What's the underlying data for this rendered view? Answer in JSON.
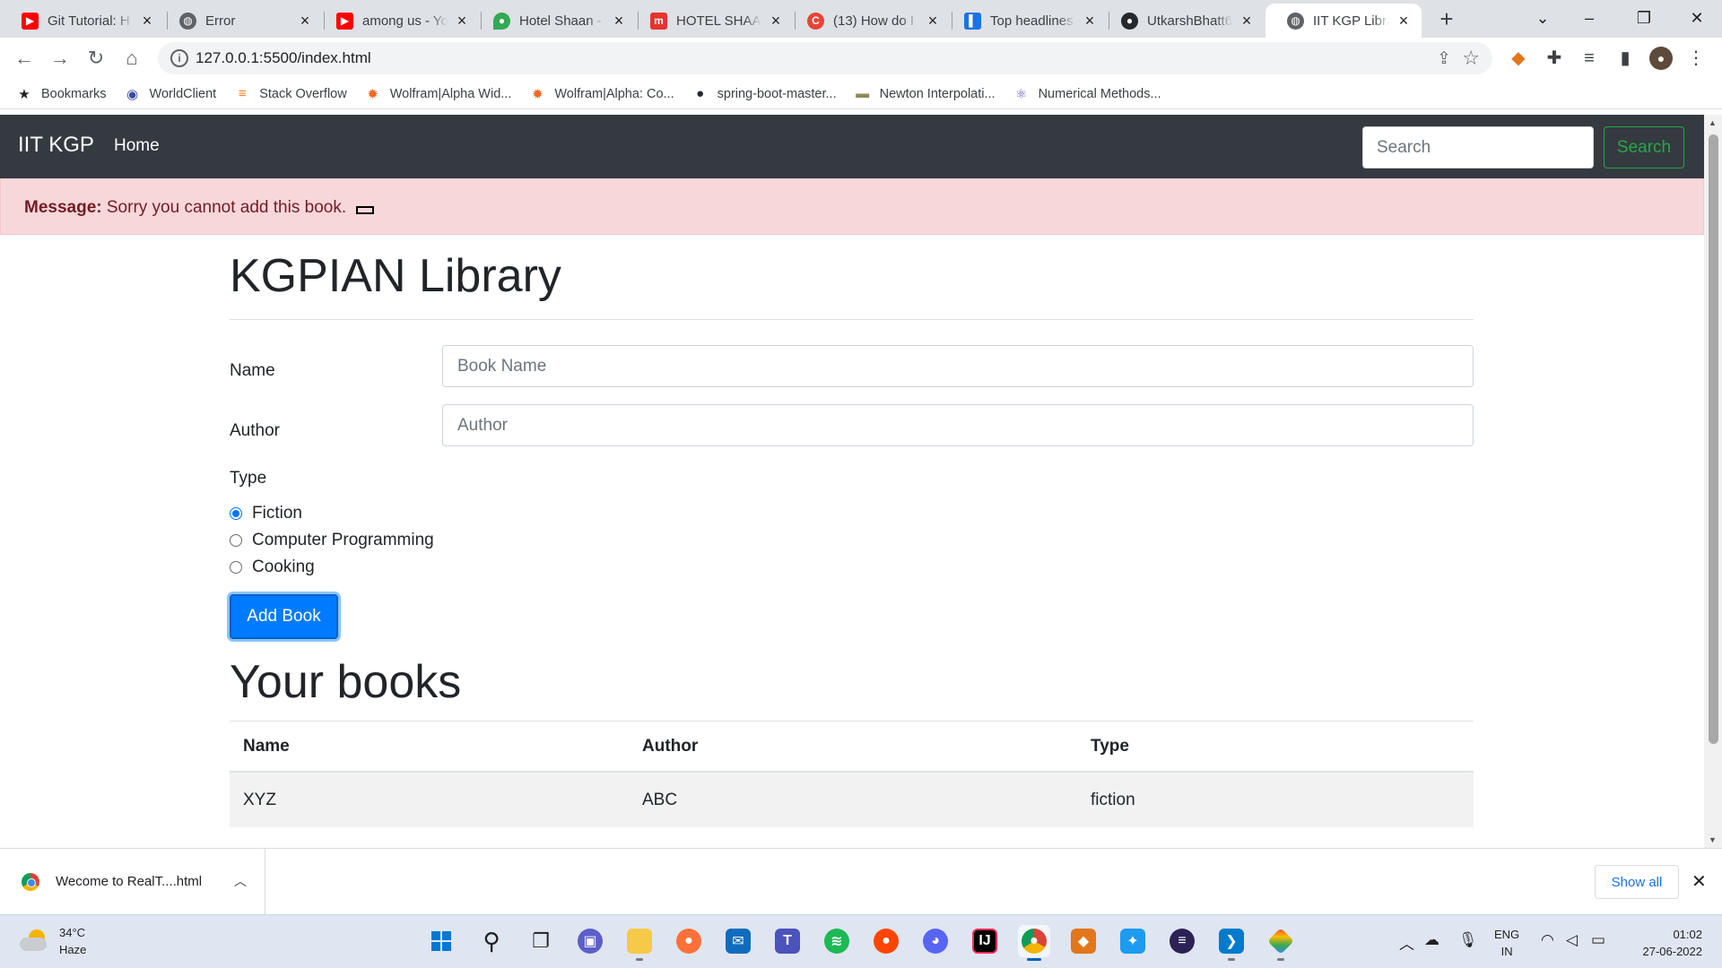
{
  "browser": {
    "tabs": [
      {
        "title": "Git Tutorial: H",
        "icon": "youtube-icon",
        "color": "#ff0000",
        "glyph": "▶"
      },
      {
        "title": "Error",
        "icon": "globe-icon",
        "color": "#5f6368",
        "glyph": "◍"
      },
      {
        "title": "among us - Yo",
        "icon": "youtube-icon",
        "color": "#ff0000",
        "glyph": "▶"
      },
      {
        "title": "Hotel Shaan -",
        "icon": "maps-pin-icon",
        "color": "#34a853",
        "glyph": "●"
      },
      {
        "title": "HOTEL SHAAN",
        "icon": "makemytrip-icon",
        "color": "#e7322d",
        "glyph": "m"
      },
      {
        "title": "(13) How do I",
        "icon": "quora-icon",
        "color": "#ea4335",
        "glyph": "C"
      },
      {
        "title": "Top headlines",
        "icon": "news-icon",
        "color": "#1a73e8",
        "glyph": "▌"
      },
      {
        "title": "UtkarshBhatt6",
        "icon": "github-icon",
        "color": "#24292e",
        "glyph": "●"
      },
      {
        "title": "IIT KGP Library",
        "icon": "globe-icon",
        "color": "#5f6368",
        "glyph": "◍",
        "active": true
      }
    ],
    "url": "127.0.0.1:5500/index.html",
    "bookmarks": [
      {
        "label": "Bookmarks",
        "icon": "star-icon",
        "glyph": "★",
        "color": "#202124"
      },
      {
        "label": "WorldClient",
        "icon": "worldclient-icon",
        "glyph": "◉",
        "color": "#3a4aa8"
      },
      {
        "label": "Stack Overflow",
        "icon": "stackoverflow-icon",
        "glyph": "≡",
        "color": "#f48024"
      },
      {
        "label": "Wolfram|Alpha Wid...",
        "icon": "wolfram-icon",
        "glyph": "✹",
        "color": "#f26722"
      },
      {
        "label": "Wolfram|Alpha: Co...",
        "icon": "wolfram-icon",
        "glyph": "✹",
        "color": "#f26722"
      },
      {
        "label": "spring-boot-master...",
        "icon": "github-icon",
        "glyph": "●",
        "color": "#24292e"
      },
      {
        "label": "Newton Interpolati...",
        "icon": "newton-icon",
        "glyph": "▬",
        "color": "#8d8a5a"
      },
      {
        "label": "Numerical Methods...",
        "icon": "atom-icon",
        "glyph": "⚛",
        "color": "#6a5acd"
      }
    ]
  },
  "site": {
    "brand": "IIT KGP",
    "nav_home": "Home",
    "search_placeholder": "Search",
    "search_button": "Search",
    "alert_label": "Message:",
    "alert_text": " Sorry you cannot add this book.",
    "title": "KGPIAN Library",
    "form": {
      "name_label": "Name",
      "name_placeholder": "Book Name",
      "author_label": "Author",
      "author_placeholder": "Author",
      "type_label": "Type",
      "types": [
        {
          "label": "Fiction",
          "checked": true
        },
        {
          "label": "Computer Programming",
          "checked": false
        },
        {
          "label": "Cooking",
          "checked": false
        }
      ],
      "submit": "Add Book"
    },
    "books_title": "Your books",
    "table": {
      "headers": [
        "Name",
        "Author",
        "Type"
      ],
      "rows": [
        [
          "XYZ",
          "ABC",
          "fiction"
        ]
      ]
    }
  },
  "downloads": {
    "file": "Wecome to RealT....html",
    "show_all": "Show all"
  },
  "taskbar": {
    "temperature": "34°C",
    "condition": "Haze",
    "lang1": "ENG",
    "lang2": "IN",
    "time": "01:02",
    "date": "27-06-2022"
  }
}
